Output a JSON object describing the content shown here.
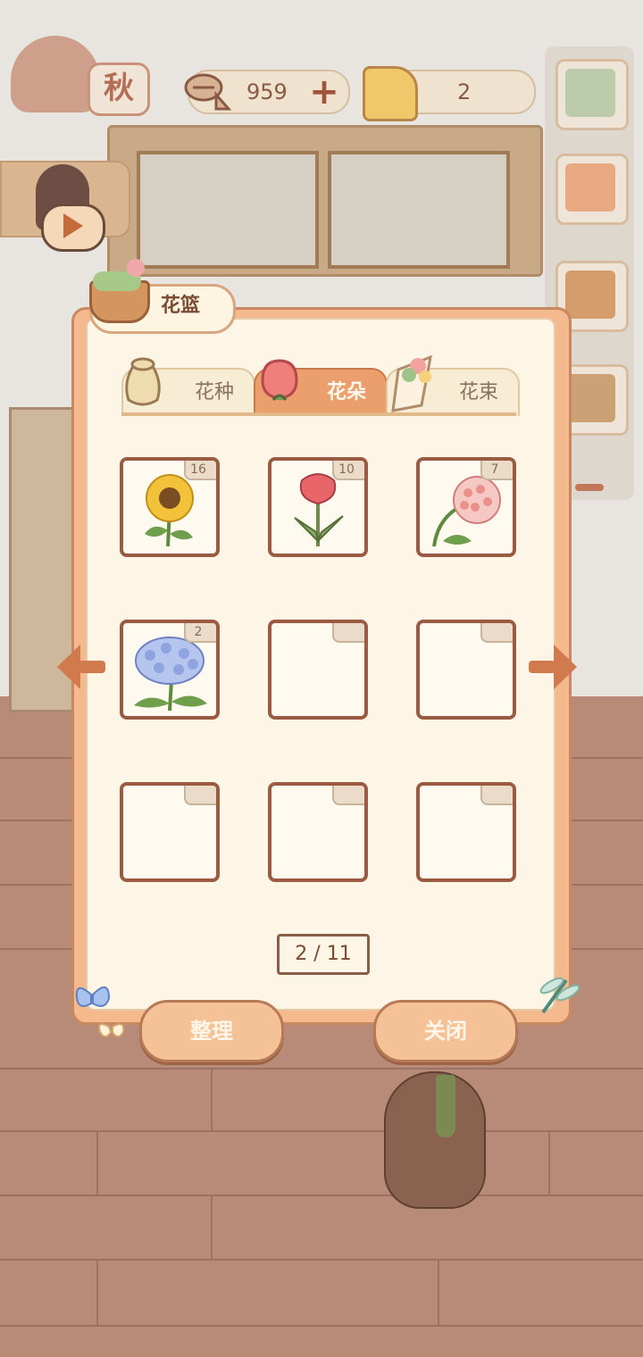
{
  "top_bar": {
    "season_label": "秋",
    "fish_count": "959",
    "cheese_count": "2"
  },
  "panel": {
    "title": "花篮",
    "tabs": [
      {
        "label": "花种",
        "active": false
      },
      {
        "label": "花朵",
        "active": true
      },
      {
        "label": "花束",
        "active": false
      }
    ],
    "slots": [
      {
        "item": "sunflower",
        "count": "16"
      },
      {
        "item": "celosia",
        "count": "10"
      },
      {
        "item": "hoya",
        "count": "7"
      },
      {
        "item": "hydrangea",
        "count": "2"
      },
      {
        "item": "",
        "count": ""
      },
      {
        "item": "",
        "count": ""
      },
      {
        "item": "",
        "count": ""
      },
      {
        "item": "",
        "count": ""
      },
      {
        "item": "",
        "count": ""
      }
    ],
    "page_indicator": "2 / 11",
    "sort_button": "整理",
    "close_button": "关闭"
  },
  "colors": {
    "panel_orange": "#f4b98c",
    "panel_cream": "#fdf6e6",
    "slot_border": "#9a5b42",
    "arrow": "#d07a4e",
    "active_tab": "#eb9f6c"
  },
  "icons": {
    "fish": "fish-bone-icon",
    "cheese": "cheese-icon",
    "plus": "plus-icon",
    "play": "play-icon",
    "basket": "basket-icon",
    "seed_bag": "seed-bag-icon",
    "rose": "rose-icon",
    "bouquet": "bouquet-icon",
    "prev": "arrow-left-icon",
    "next": "arrow-right-icon"
  }
}
